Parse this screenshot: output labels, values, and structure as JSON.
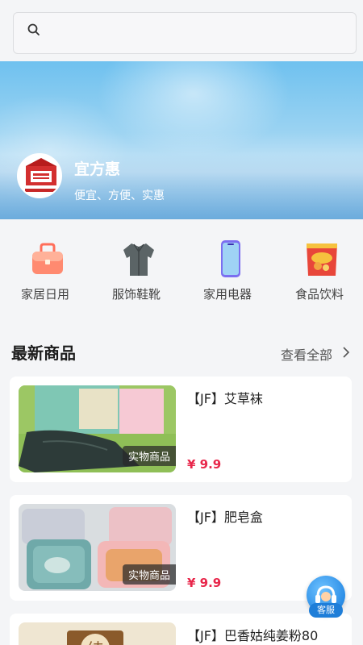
{
  "search": {
    "placeholder": ""
  },
  "store": {
    "name": "宜方惠",
    "slogan": "便宜、方便、实惠"
  },
  "categories": [
    {
      "label": "家居日用",
      "icon": "storage-box-icon"
    },
    {
      "label": "服饰鞋靴",
      "icon": "jacket-icon"
    },
    {
      "label": "家用电器",
      "icon": "phone-icon"
    },
    {
      "label": "食品饮料",
      "icon": "snack-bag-icon"
    }
  ],
  "section": {
    "title": "最新商品",
    "view_all": "查看全部"
  },
  "products": [
    {
      "name": "【JF】艾草袜",
      "price": "¥ 9.9",
      "tag": "实物商品"
    },
    {
      "name": "【JF】肥皂盒",
      "price": "¥ 9.9",
      "tag": "实物商品"
    },
    {
      "name": "【JF】巴香姑纯姜粉80",
      "price": "",
      "tag": ""
    }
  ],
  "customer_service": {
    "label": "客服"
  },
  "colors": {
    "price": "#e8264a",
    "accent": "#2b8de6"
  }
}
